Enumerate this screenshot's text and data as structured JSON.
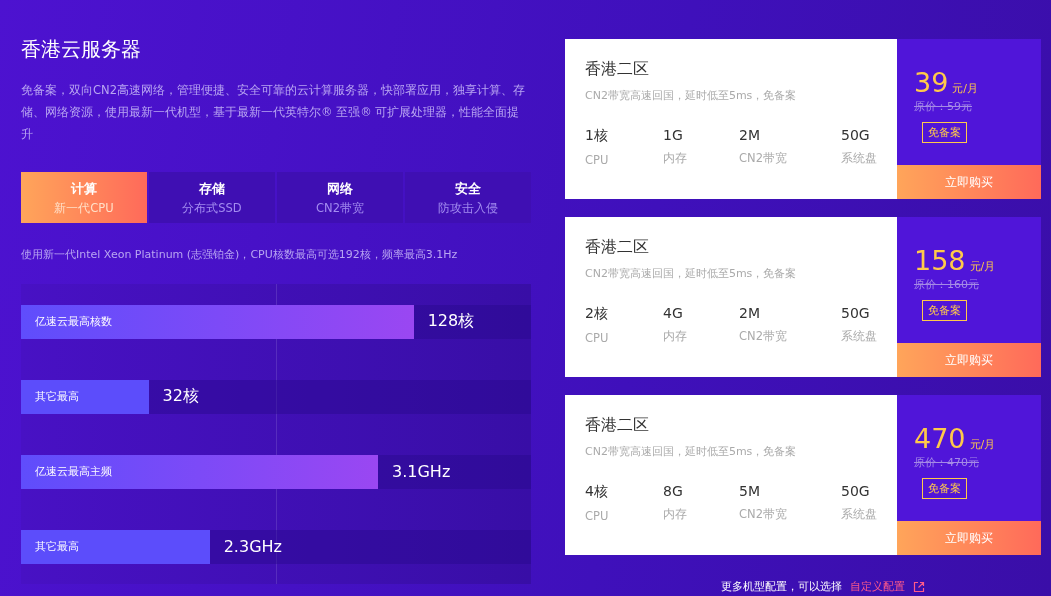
{
  "title": "香港云服务器",
  "description": "免备案，双向CN2高速网络，管理便捷、安全可靠的云计算服务器，快部署应用，独享计算、存储、网络资源，使用最新一代机型，基于最新一代英特尔® 至强® 可扩展处理器，性能全面提升",
  "tabs": [
    {
      "label": "计算",
      "sub": "新一代CPU",
      "selected": true
    },
    {
      "label": "存储",
      "sub": "分布式SSD",
      "selected": false
    },
    {
      "label": "网络",
      "sub": "CN2带宽",
      "selected": false
    },
    {
      "label": "安全",
      "sub": "防攻击入侵",
      "selected": false
    }
  ],
  "tab_note": "使用新一代Intel Xeon Platinum (志强铂金)，CPU核数最高可选192核，频率最高3.1Hz",
  "comparison": [
    {
      "kind": "highlight",
      "label": "亿速云最高核数",
      "value": "128核",
      "level": 0.77
    },
    {
      "kind": "plain",
      "label": "其它最高",
      "value": "32核",
      "level": 0.25
    },
    {
      "kind": "highlight",
      "label": "亿速云最高主频",
      "value": "3.1GHz",
      "level": 0.7
    },
    {
      "kind": "plain",
      "label": "其它最高",
      "value": "2.3GHz",
      "level": 0.37
    }
  ],
  "plans": [
    {
      "region": "香港二区",
      "tagline": "CN2带宽高速回国，延时低至5ms，免备案",
      "specs": [
        {
          "value": "1核",
          "label": "CPU"
        },
        {
          "value": "1G",
          "label": "内存"
        },
        {
          "value": "2M",
          "label": "CN2带宽"
        },
        {
          "value": "50G",
          "label": "系统盘"
        }
      ],
      "price": "39",
      "unit": "元/月",
      "original_price": "原价：59元",
      "badge": "免备案",
      "button": "立即购买"
    },
    {
      "region": "香港二区",
      "tagline": "CN2带宽高速回国，延时低至5ms，免备案",
      "specs": [
        {
          "value": "2核",
          "label": "CPU"
        },
        {
          "value": "4G",
          "label": "内存"
        },
        {
          "value": "2M",
          "label": "CN2带宽"
        },
        {
          "value": "50G",
          "label": "系统盘"
        }
      ],
      "price": "158",
      "unit": "元/月",
      "original_price": "原价：160元",
      "badge": "免备案",
      "button": "立即购买"
    },
    {
      "region": "香港二区",
      "tagline": "CN2带宽高速回国，延时低至5ms，免备案",
      "specs": [
        {
          "value": "4核",
          "label": "CPU"
        },
        {
          "value": "8G",
          "label": "内存"
        },
        {
          "value": "5M",
          "label": "CN2带宽"
        },
        {
          "value": "50G",
          "label": "系统盘"
        }
      ],
      "price": "470",
      "unit": "元/月",
      "original_price": "原价：470元",
      "badge": "免备案",
      "button": "立即购买"
    }
  ],
  "footer": {
    "text": "更多机型配置，可以选择",
    "link": "自定义配置"
  }
}
